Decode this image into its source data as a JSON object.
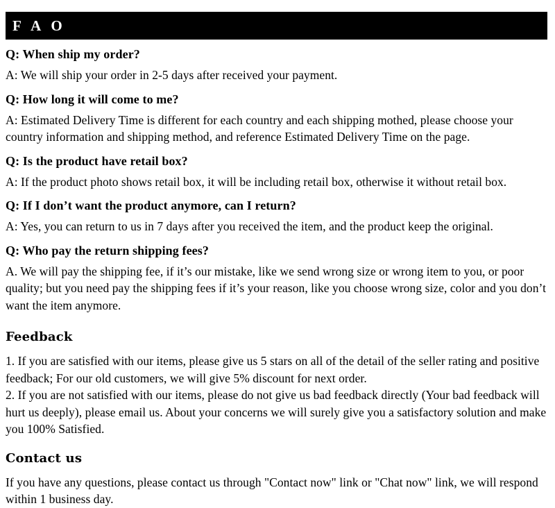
{
  "header": {
    "title": "F A O"
  },
  "faq": {
    "items": [
      {
        "question": "Q: When ship my order?",
        "answer": "A: We will ship your order in 2-5 days after received your payment."
      },
      {
        "question": "Q: How long it will come to me?",
        "answer": "A: Estimated Delivery Time is different for each country and each shipping mothed, please choose your country information and shipping method, and reference Estimated Delivery Time on the page."
      },
      {
        "question": "Q: Is the product have retail box?",
        "answer": "A: If  the product photo shows retail box, it will be including retail box, otherwise it without retail box."
      },
      {
        "question": "Q: If  I don’t want the product anymore, can I return?",
        "answer": "A: Yes, you can return to us in 7 days after you received the item, and the product keep the original."
      },
      {
        "question": "Q: Who pay the return shipping fees?",
        "answer": "A.  We will pay the shipping fee, if  it’s our mistake, like we send wrong size or wrong item to you, or poor quality; but you need pay the shipping fees if  it’s your reason, like you choose wrong size, color and you don’t want the item anymore."
      }
    ]
  },
  "feedback": {
    "heading": "Feedback",
    "items": [
      "1.  If you are satisfied with our items, please give us 5 stars on all of the detail of the seller rating and positive feedback; For our old customers, we will give 5% discount for next order.",
      "2.  If you are not satisfied with our items, please do not give us bad feedback directly (Your bad feedback will hurt us deeply), please email us. About your concerns we will surely give you a satisfactory solution and make you 100% Satisfied."
    ]
  },
  "contact": {
    "heading": "Contact us",
    "text": "If you have any questions, please contact us through \"Contact now\" link or \"Chat now\" link, we will respond within 1 business day."
  },
  "colors": {
    "header_background": "#000000",
    "header_text": "#ffffff",
    "page_background": "#ffffff",
    "body_text": "#000000"
  }
}
